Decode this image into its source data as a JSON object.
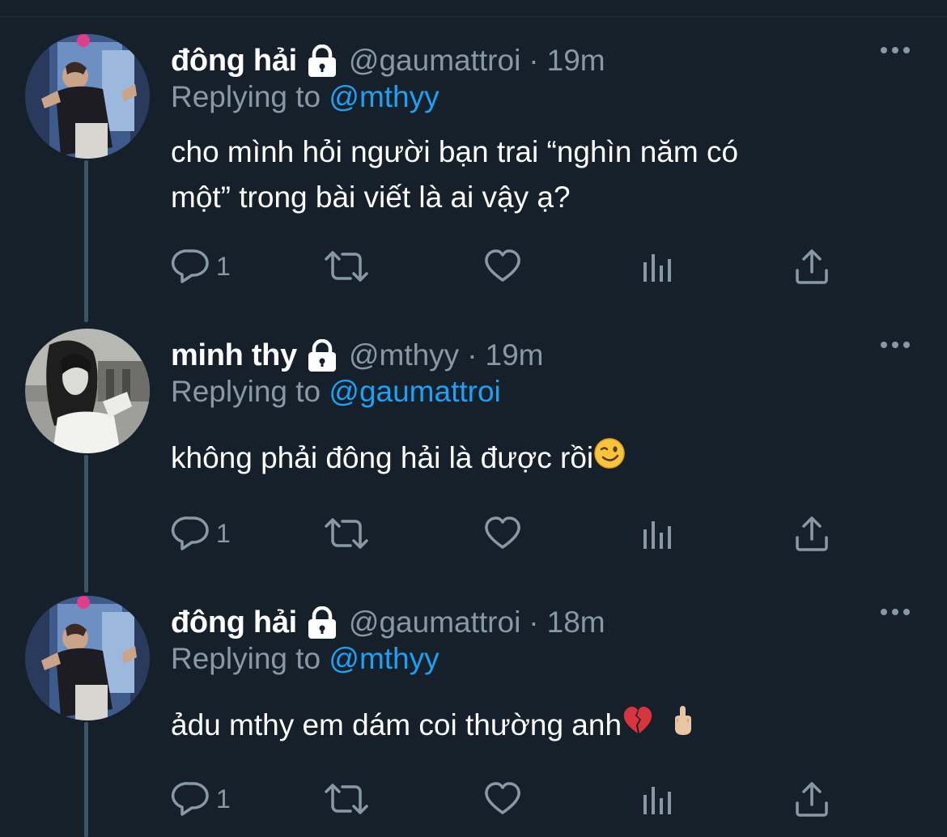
{
  "icons": {
    "lock": "lock-icon",
    "more": "more-icon",
    "reply": "reply-icon",
    "retweet": "retweet-icon",
    "like": "like-icon",
    "analytics": "analytics-icon",
    "share": "share-icon"
  },
  "colors": {
    "background": "#15202b",
    "secondary_text": "#8899a6",
    "link": "#1da1f2",
    "thread_line": "#3d5466"
  },
  "tweets": [
    {
      "display_name": "đông hải",
      "handle": "@gaumattroi",
      "separator": "·",
      "time": "19m",
      "replying_prefix": "Replying to",
      "replying_to": "@mthyy",
      "text_line1": "cho mình hỏi người bạn trai “nghìn năm có",
      "text_line2": "một” trong bài viết là ai vậy ạ?",
      "reply_count": "1"
    },
    {
      "display_name": "minh thy",
      "handle": "@mthyy",
      "separator": "·",
      "time": "19m",
      "replying_prefix": "Replying to",
      "replying_to": "@gaumattroi",
      "text": "không phải đông hải là được rồi",
      "emoji": "winking-face",
      "reply_count": "1"
    },
    {
      "display_name": "đông hải",
      "handle": "@gaumattroi",
      "separator": "·",
      "time": "18m",
      "replying_prefix": "Replying to",
      "replying_to": "@mthyy",
      "text": "ảdu mthy em dám coi thường anh",
      "emoji": "broken-heart, middle-finger",
      "reply_count": "1"
    }
  ]
}
